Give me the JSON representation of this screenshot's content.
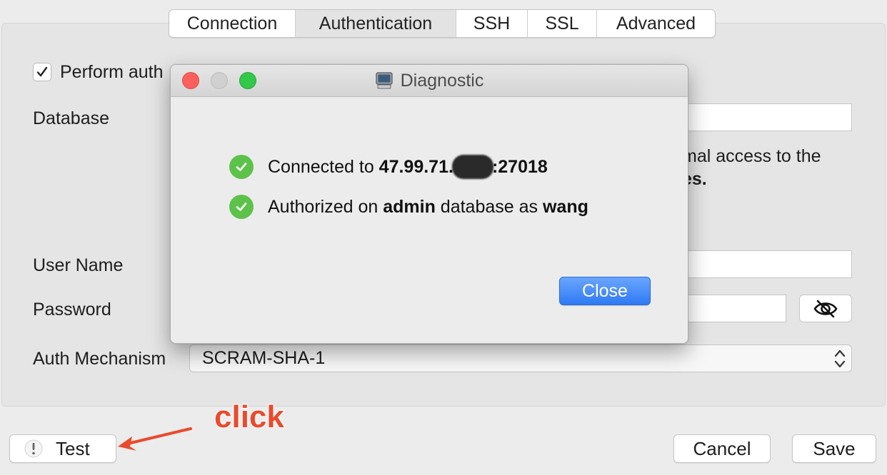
{
  "tabs": [
    "Connection",
    "Authentication",
    "SSH",
    "SSL",
    "Advanced"
  ],
  "active_tab": "Authentication",
  "auth": {
    "perform_auth_label": "Perform auth",
    "perform_auth_checked": true,
    "database_label": "Database",
    "note_line1": "mal access to the",
    "note_line2": "es.",
    "user_name_label": "User Name",
    "password_label": "Password",
    "auth_mechanism_label": "Auth Mechanism",
    "auth_mechanism_value": "SCRAM-SHA-1"
  },
  "dialog": {
    "title": "Diagnostic",
    "title_icon": "computer-icon",
    "status": [
      {
        "prefix": "Connected to ",
        "host_visible": "47.99.71.",
        "port_suffix": ":27018",
        "icon": "check-circle-icon"
      },
      {
        "prefix": "Authorized on ",
        "database": "admin",
        "middle": " database as ",
        "user": "wang",
        "icon": "check-circle-icon"
      }
    ],
    "close_label": "Close"
  },
  "footer": {
    "test_label": "Test",
    "cancel_label": "Cancel",
    "save_label": "Save"
  },
  "annotation": {
    "text": "click"
  },
  "colors": {
    "accent_blue": "#2f79f3",
    "success_green": "#5dc24a",
    "annotation_red": "#ea4a2d"
  }
}
